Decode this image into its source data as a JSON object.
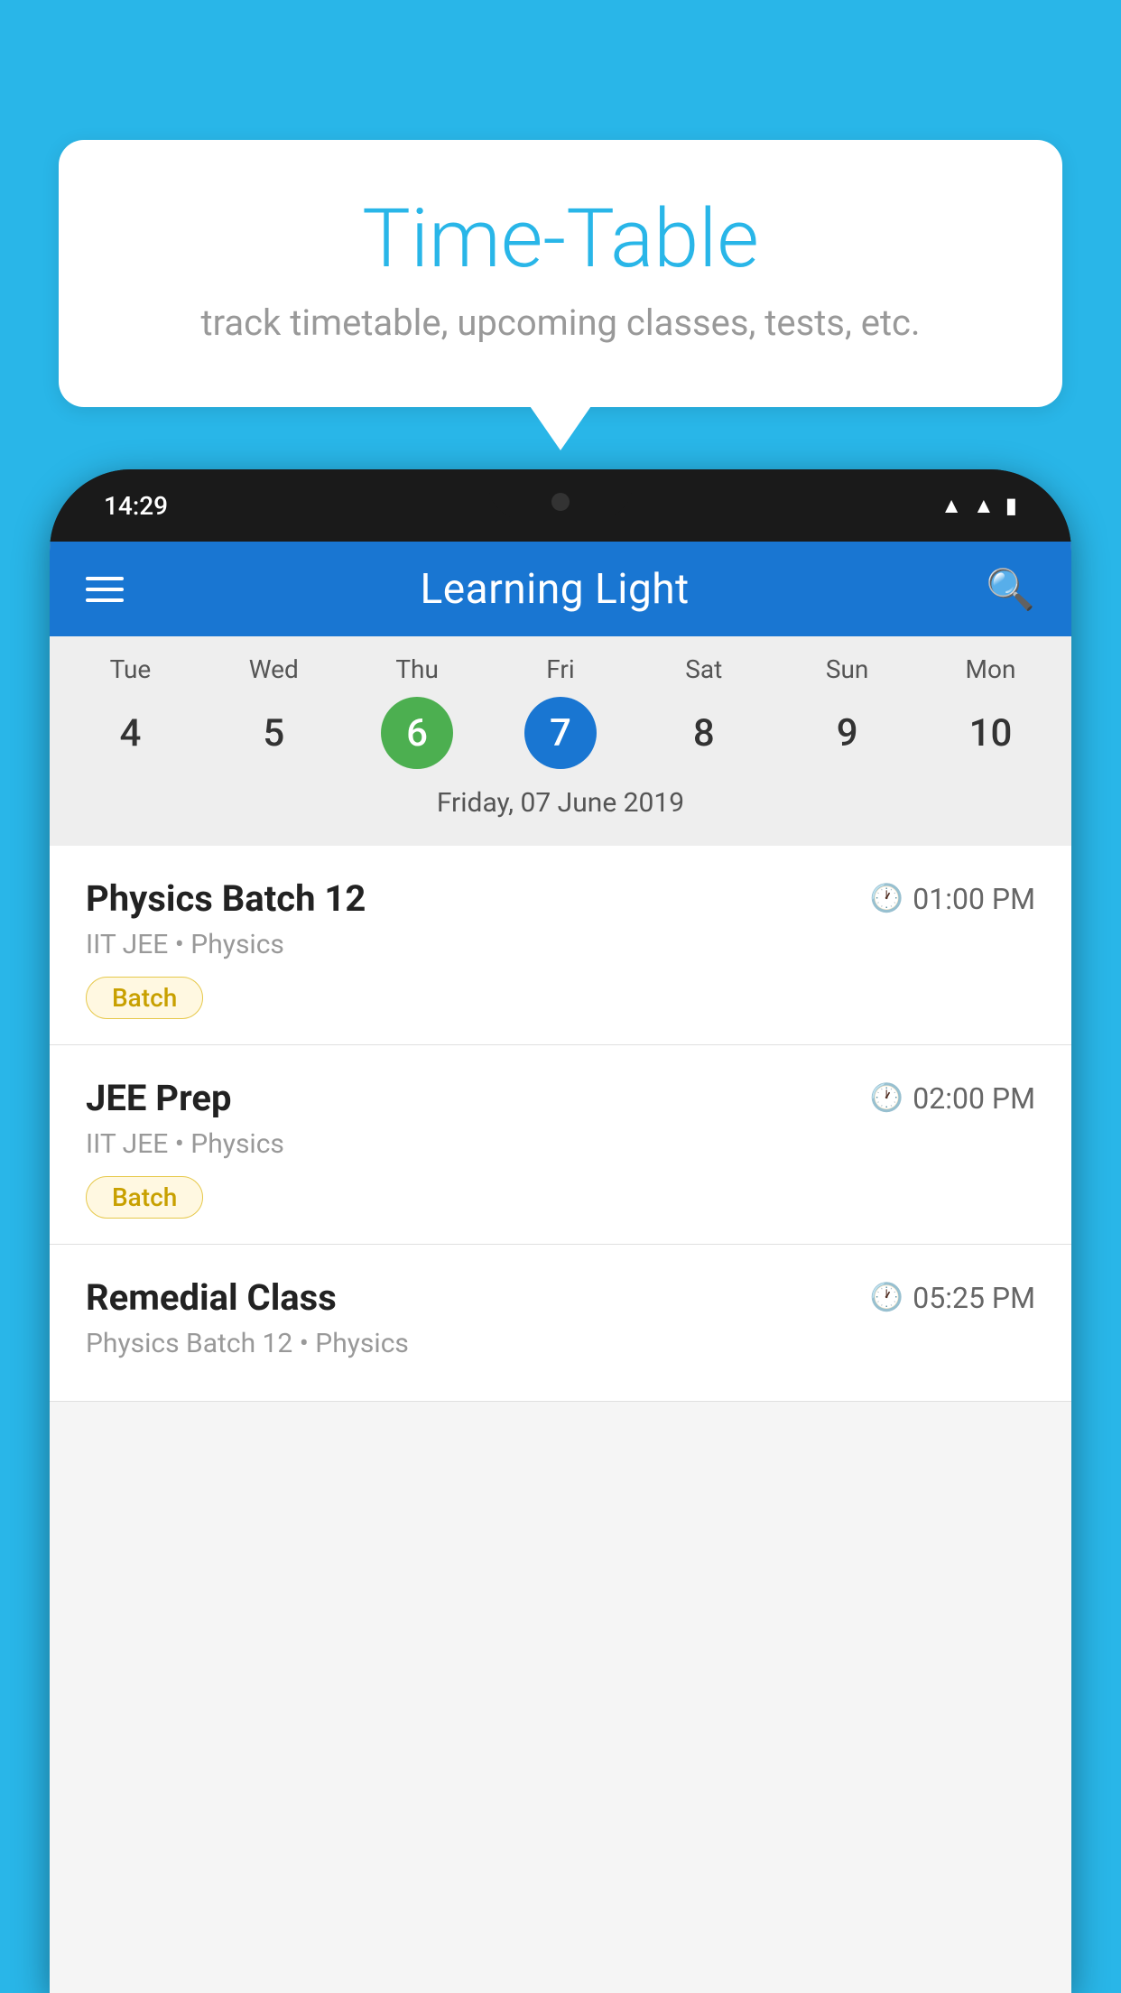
{
  "background_color": "#29b6e8",
  "bubble": {
    "title": "Time-Table",
    "subtitle": "track timetable, upcoming classes, tests, etc."
  },
  "phone": {
    "time": "14:29",
    "app_title": "Learning Light",
    "hamburger_label": "Menu",
    "search_label": "Search"
  },
  "calendar": {
    "days": [
      {
        "short": "Tue",
        "num": "4",
        "state": "normal"
      },
      {
        "short": "Wed",
        "num": "5",
        "state": "normal"
      },
      {
        "short": "Thu",
        "num": "6",
        "state": "today"
      },
      {
        "short": "Fri",
        "num": "7",
        "state": "selected"
      },
      {
        "short": "Sat",
        "num": "8",
        "state": "normal"
      },
      {
        "short": "Sun",
        "num": "9",
        "state": "normal"
      },
      {
        "short": "Mon",
        "num": "10",
        "state": "normal"
      }
    ],
    "selected_date_label": "Friday, 07 June 2019"
  },
  "classes": [
    {
      "name": "Physics Batch 12",
      "time": "01:00 PM",
      "meta": "IIT JEE • Physics",
      "badge": "Batch"
    },
    {
      "name": "JEE Prep",
      "time": "02:00 PM",
      "meta": "IIT JEE • Physics",
      "badge": "Batch"
    },
    {
      "name": "Remedial Class",
      "time": "05:25 PM",
      "meta": "Physics Batch 12 • Physics",
      "badge": null
    }
  ]
}
